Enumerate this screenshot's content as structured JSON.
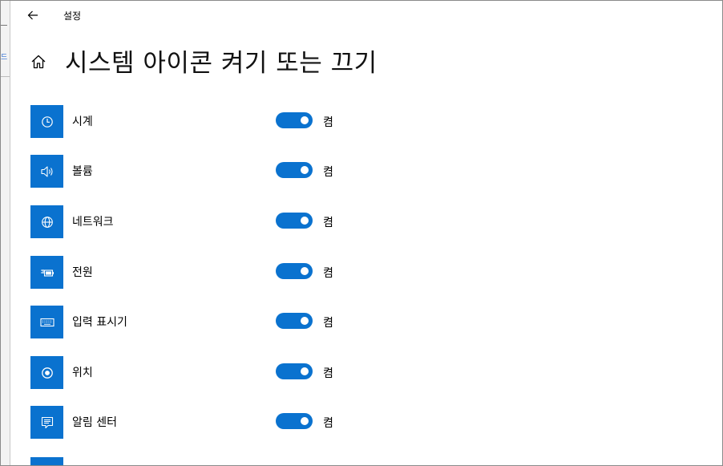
{
  "window": {
    "title": "설정",
    "page_title": "시스템 아이콘 켜기 또는 끄기"
  },
  "background_window": {
    "fragment": "드"
  },
  "colors": {
    "accent": "#0a72cf",
    "background": "#ffffff"
  },
  "icons": [
    {
      "icon": "clock-icon",
      "label": "시계",
      "state": "켬",
      "on": true
    },
    {
      "icon": "volume-icon",
      "label": "볼륨",
      "state": "켬",
      "on": true
    },
    {
      "icon": "network-icon",
      "label": "네트워크",
      "state": "켬",
      "on": true
    },
    {
      "icon": "power-icon",
      "label": "전원",
      "state": "켬",
      "on": true
    },
    {
      "icon": "keyboard-icon",
      "label": "입력 표시기",
      "state": "켬",
      "on": true
    },
    {
      "icon": "location-icon",
      "label": "위치",
      "state": "켬",
      "on": true
    },
    {
      "icon": "action-center-icon",
      "label": "알림 센터",
      "state": "켬",
      "on": true
    }
  ]
}
